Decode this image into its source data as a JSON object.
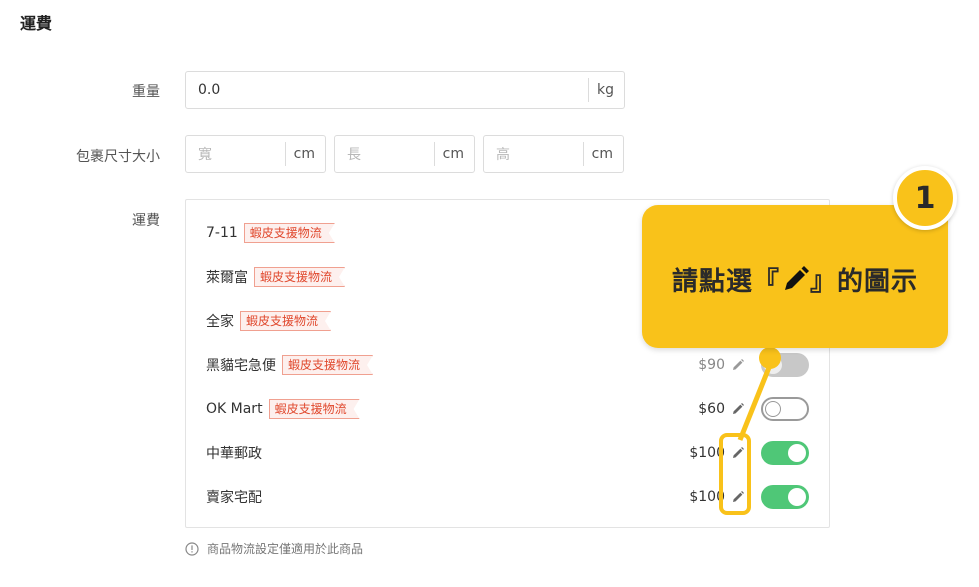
{
  "section_title": "運費",
  "weight": {
    "label": "重量",
    "value": "0.0",
    "unit": "kg"
  },
  "package_size": {
    "label": "包裹尺寸大小",
    "fields": [
      {
        "placeholder": "寬",
        "unit": "cm"
      },
      {
        "placeholder": "長",
        "unit": "cm"
      },
      {
        "placeholder": "高",
        "unit": "cm"
      }
    ]
  },
  "shipping": {
    "label": "運費",
    "tag_text": "蝦皮支援物流",
    "carriers": [
      {
        "name": "7-11",
        "has_tag": true
      },
      {
        "name": "萊爾富",
        "has_tag": true
      },
      {
        "name": "全家",
        "has_tag": true
      },
      {
        "name": "黑貓宅急便",
        "has_tag": true,
        "price": "$90",
        "state": "disabled"
      },
      {
        "name": "OK Mart",
        "has_tag": true,
        "price": "$60",
        "state": "off"
      },
      {
        "name": "中華郵政",
        "has_tag": false,
        "price": "$100",
        "state": "on"
      },
      {
        "name": "賣家宅配",
        "has_tag": false,
        "price": "$100",
        "state": "on"
      }
    ]
  },
  "note": "商品物流設定僅適用於此商品",
  "callout": {
    "step": "1",
    "text_before": "請點選『",
    "text_after": "』的圖示",
    "icon": "pencil-icon"
  },
  "colors": {
    "accent": "#f9c21a",
    "toggle_on": "#4fc777",
    "tag_red": "#e0482d"
  }
}
